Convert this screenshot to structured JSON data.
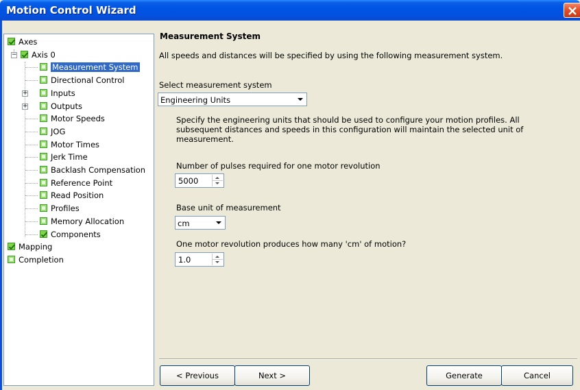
{
  "window": {
    "title": "Motion Control Wizard",
    "title_bar_color": "#0054e3",
    "close_icon": "close-icon"
  },
  "tree": {
    "items": [
      {
        "label": "Axes",
        "state": "checked"
      },
      {
        "label": "Axis 0",
        "state": "checked",
        "expander": "−"
      },
      {
        "label": "Measurement System",
        "state": "empty",
        "selected": true
      },
      {
        "label": "Directional Control",
        "state": "empty"
      },
      {
        "label": "Inputs",
        "state": "empty",
        "expander": "+"
      },
      {
        "label": "Outputs",
        "state": "empty",
        "expander": "+"
      },
      {
        "label": "Motor Speeds",
        "state": "empty"
      },
      {
        "label": "JOG",
        "state": "empty"
      },
      {
        "label": "Motor Times",
        "state": "empty"
      },
      {
        "label": "Jerk Time",
        "state": "empty"
      },
      {
        "label": "Backlash Compensation",
        "state": "empty"
      },
      {
        "label": "Reference Point",
        "state": "empty"
      },
      {
        "label": "Read Position",
        "state": "empty"
      },
      {
        "label": "Profiles",
        "state": "empty"
      },
      {
        "label": "Memory Allocation",
        "state": "empty"
      },
      {
        "label": "Components",
        "state": "checked"
      },
      {
        "label": "Mapping",
        "state": "checked"
      },
      {
        "label": "Completion",
        "state": "empty"
      }
    ]
  },
  "main": {
    "section_title": "Measurement System",
    "intro": "All speeds and distances will be specified by using the following measurement system.",
    "select_label": "Select measurement system",
    "measurement_system": "Engineering Units",
    "description": "Specify the engineering units that should be used to configure your motion profiles.  All subsequent distances and speeds in this configuration will maintain the selected unit of measurement.",
    "pulses_label": "Number of pulses required for one motor revolution",
    "pulses_value": "5000",
    "base_unit_label": "Base unit of measurement",
    "base_unit_value": "cm",
    "revolution_label": "One motor revolution produces how many 'cm' of motion?",
    "revolution_value": "1.0"
  },
  "buttons": {
    "previous": "< Previous",
    "next": "Next >",
    "generate": "Generate",
    "cancel": "Cancel"
  },
  "colors": {
    "selection": "#316ac5",
    "checkbox_green": "#7fd44a",
    "dialog_bg": "#ece9d8"
  }
}
